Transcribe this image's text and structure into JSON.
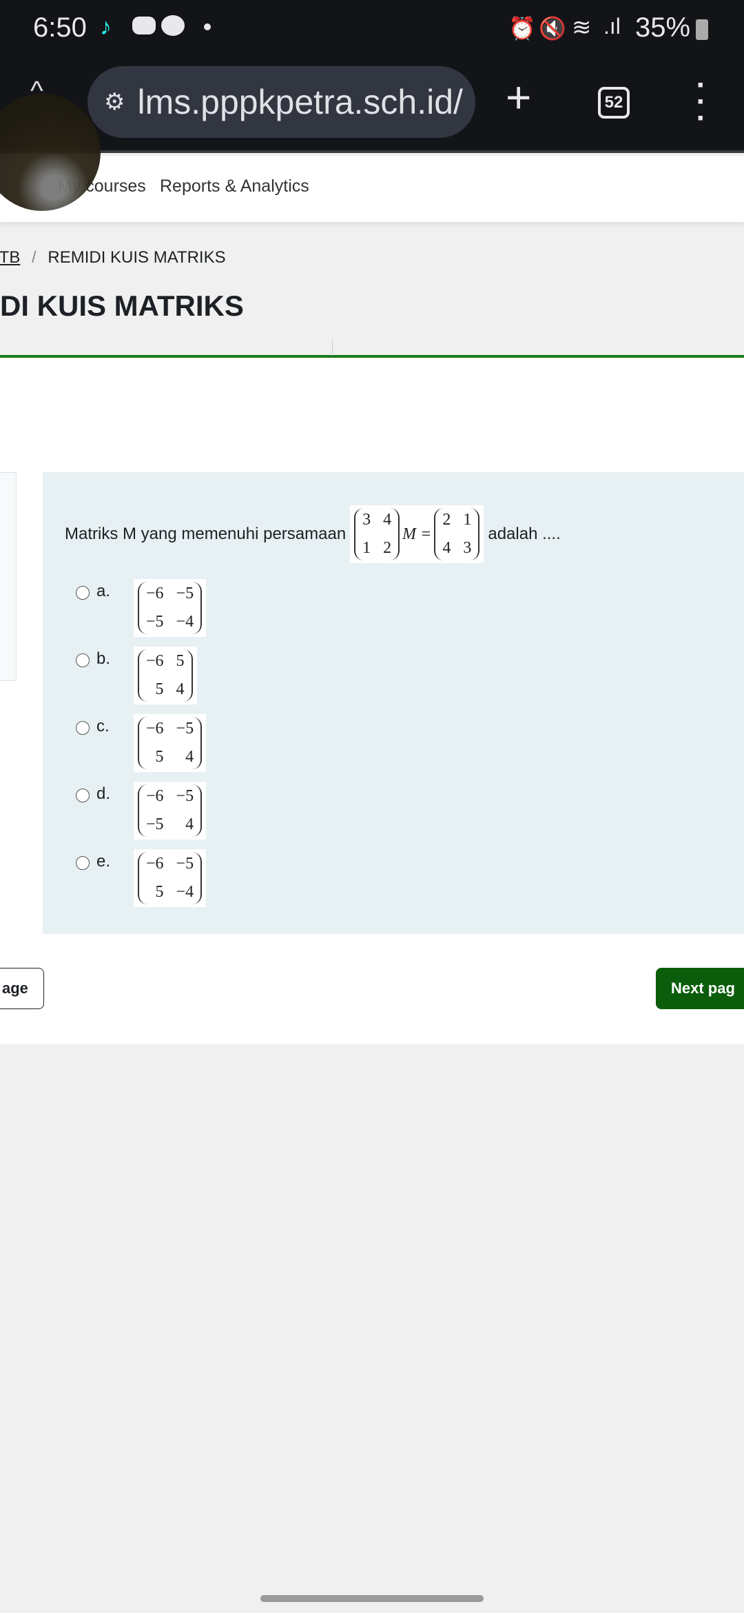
{
  "status": {
    "time": "6:50",
    "battery": "35%",
    "notifications": [
      "tiktok-icon",
      "discord-icon",
      "line-icon"
    ],
    "icons": [
      "alarm-icon",
      "mute-icon",
      "wifi-icon",
      "signal-icon",
      "battery-icon"
    ]
  },
  "browser": {
    "url": "lms.pppkpetra.sch.id/",
    "tab_count": "52"
  },
  "nav": {
    "items": [
      "My courses",
      "Reports & Analytics"
    ]
  },
  "breadcrumb": {
    "parent": "ITB",
    "separator": "/",
    "current": "REMIDI KUIS MATRIKS"
  },
  "page_title": "DI KUIS MATRIKS",
  "question": {
    "prefix": "Matriks M yang memenuhi persamaan",
    "left_matrix": [
      "3",
      "4",
      "1",
      "2"
    ],
    "variable": "M =",
    "right_matrix": [
      "2",
      "1",
      "4",
      "3"
    ],
    "suffix": "adalah ....",
    "options": [
      {
        "label": "a.",
        "matrix": [
          "−6",
          "−5",
          "−5",
          "−4"
        ]
      },
      {
        "label": "b.",
        "matrix": [
          "−6",
          "5",
          "5",
          "4"
        ]
      },
      {
        "label": "c.",
        "matrix": [
          "−6",
          "−5",
          "5",
          "4"
        ]
      },
      {
        "label": "d.",
        "matrix": [
          "−6",
          "−5",
          "−5",
          "4"
        ]
      },
      {
        "label": "e.",
        "matrix": [
          "−6",
          "−5",
          "5",
          "−4"
        ]
      }
    ]
  },
  "buttons": {
    "prev": "age",
    "next": "Next pag"
  },
  "colors": {
    "accent": "#0b5d0b",
    "question_bg": "#e7f0f3"
  }
}
